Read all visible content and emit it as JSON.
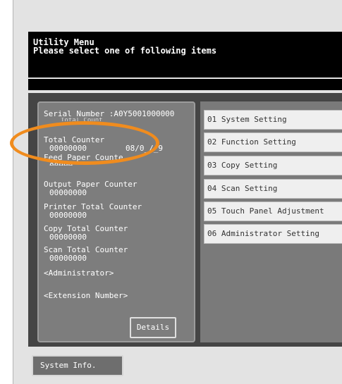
{
  "header": {
    "title": "Utility Menu",
    "subtitle": "Please select one of following items"
  },
  "info": {
    "serial_number": "Serial Number  :A0Y5001000000",
    "partial_obscured": "Total Count",
    "total_counter_label": "Total Counter",
    "total_counter_value": "00000000",
    "total_counter_date": "08/0_/_9",
    "feed_paper_label": "Feed Paper Counte",
    "feed_paper_value": "00000",
    "output_paper_label": "Output Paper Counter",
    "output_paper_value": "00000000",
    "printer_total_label": "Printer Total Counter",
    "printer_total_value": "00000000",
    "copy_total_label": "Copy Total Counter",
    "copy_total_value": "00000000",
    "scan_total_label": "Scan Total Counter",
    "scan_total_value": "00000000",
    "administrator": "<Administrator>",
    "extension_number": "<Extension Number>",
    "details_button": "Details"
  },
  "menu": {
    "items": [
      {
        "label": "01 System Setting"
      },
      {
        "label": "02 Function Setting"
      },
      {
        "label": "03 Copy Setting"
      },
      {
        "label": "04 Scan Setting"
      },
      {
        "label": "05 Touch Panel Adjustment"
      },
      {
        "label": "06 Administrator Setting"
      }
    ]
  },
  "footer": {
    "system_info_button": "System Info."
  },
  "colors": {
    "highlight": "#f08c1e",
    "header_bg": "#000000",
    "body_bg": "#454545"
  }
}
